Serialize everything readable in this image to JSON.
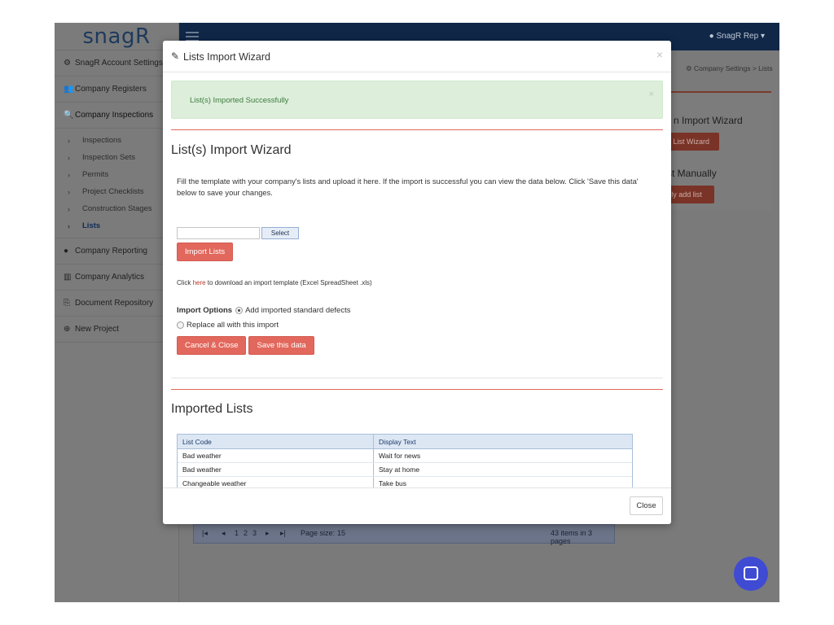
{
  "app": {
    "logo": "snagR",
    "user": "SnagR Rep",
    "user_caret": "▾"
  },
  "sidebar": {
    "items": [
      {
        "label": "SnagR Account Settings",
        "icon": "⚙"
      },
      {
        "label": "Company Registers",
        "icon": "👥"
      },
      {
        "label": "Company Inspections",
        "icon": "🔍"
      }
    ],
    "sub_items": [
      {
        "label": "Inspections"
      },
      {
        "label": "Inspection Sets"
      },
      {
        "label": "Permits"
      },
      {
        "label": "Project Checklists"
      },
      {
        "label": "Construction Stages"
      },
      {
        "label": "Lists"
      }
    ],
    "items_after": [
      {
        "label": "Company Reporting",
        "icon": "●"
      },
      {
        "label": "Company Analytics",
        "icon": "▥"
      },
      {
        "label": "Document Repository",
        "icon": "⎘"
      },
      {
        "label": "New Project",
        "icon": "⊕"
      }
    ]
  },
  "background": {
    "breadcrumb_1": "Company Settings",
    "breadcrumb_sep": ">",
    "breadcrumb_2": "Lists",
    "panel_title_1": "n Import Wizard",
    "panel_btn_1": "n List Wizard",
    "panel_title_2": "st Manually",
    "panel_btn_2": "lly add list",
    "pager": {
      "pages": [
        "1",
        "2",
        "3"
      ],
      "page_size_label": "Page size:",
      "page_size_value": "15",
      "summary": "43 items in 3 pages"
    }
  },
  "modal": {
    "title": "Lists Import Wizard",
    "close_x": "×",
    "alert_text": "List(s) Imported Successfully",
    "alert_close": "×",
    "heading": "List(s) Import Wizard",
    "description": "Fill the template with your company's lists and upload it here. If the import is successful you can view the data below. Click 'Save this data' below to save your changes.",
    "select_label": "Select",
    "import_button": "Import Lists",
    "template_prefix": "Click ",
    "template_link": "here",
    "template_suffix": " to download an import template (Excel SpreadSheet .xls)",
    "import_options_label": "Import Options",
    "option_1": "Add imported standard defects",
    "option_2": "Replace all with this import",
    "cancel_button": "Cancel & Close",
    "save_button": "Save this data",
    "imported_heading": "Imported Lists",
    "table": {
      "headers": [
        "List Code",
        "Display Text"
      ],
      "rows": [
        [
          "Bad weather",
          "Wait for news"
        ],
        [
          "Bad weather",
          "Stay at home"
        ],
        [
          "Changeable weather",
          "Take bus"
        ]
      ]
    },
    "footer_close": "Close"
  }
}
